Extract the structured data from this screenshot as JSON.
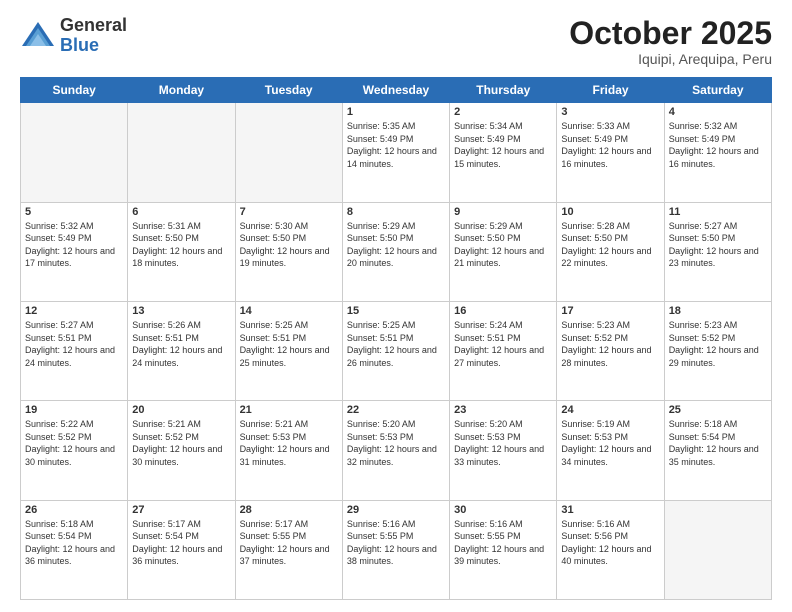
{
  "logo": {
    "general": "General",
    "blue": "Blue"
  },
  "header": {
    "month": "October 2025",
    "location": "Iquipi, Arequipa, Peru"
  },
  "weekdays": [
    "Sunday",
    "Monday",
    "Tuesday",
    "Wednesday",
    "Thursday",
    "Friday",
    "Saturday"
  ],
  "weeks": [
    [
      {
        "day": "",
        "sunrise": "",
        "sunset": "",
        "daylight": "",
        "empty": true
      },
      {
        "day": "",
        "sunrise": "",
        "sunset": "",
        "daylight": "",
        "empty": true
      },
      {
        "day": "",
        "sunrise": "",
        "sunset": "",
        "daylight": "",
        "empty": true
      },
      {
        "day": "1",
        "sunrise": "Sunrise: 5:35 AM",
        "sunset": "Sunset: 5:49 PM",
        "daylight": "Daylight: 12 hours and 14 minutes."
      },
      {
        "day": "2",
        "sunrise": "Sunrise: 5:34 AM",
        "sunset": "Sunset: 5:49 PM",
        "daylight": "Daylight: 12 hours and 15 minutes."
      },
      {
        "day": "3",
        "sunrise": "Sunrise: 5:33 AM",
        "sunset": "Sunset: 5:49 PM",
        "daylight": "Daylight: 12 hours and 16 minutes."
      },
      {
        "day": "4",
        "sunrise": "Sunrise: 5:32 AM",
        "sunset": "Sunset: 5:49 PM",
        "daylight": "Daylight: 12 hours and 16 minutes."
      }
    ],
    [
      {
        "day": "5",
        "sunrise": "Sunrise: 5:32 AM",
        "sunset": "Sunset: 5:49 PM",
        "daylight": "Daylight: 12 hours and 17 minutes."
      },
      {
        "day": "6",
        "sunrise": "Sunrise: 5:31 AM",
        "sunset": "Sunset: 5:50 PM",
        "daylight": "Daylight: 12 hours and 18 minutes."
      },
      {
        "day": "7",
        "sunrise": "Sunrise: 5:30 AM",
        "sunset": "Sunset: 5:50 PM",
        "daylight": "Daylight: 12 hours and 19 minutes."
      },
      {
        "day": "8",
        "sunrise": "Sunrise: 5:29 AM",
        "sunset": "Sunset: 5:50 PM",
        "daylight": "Daylight: 12 hours and 20 minutes."
      },
      {
        "day": "9",
        "sunrise": "Sunrise: 5:29 AM",
        "sunset": "Sunset: 5:50 PM",
        "daylight": "Daylight: 12 hours and 21 minutes."
      },
      {
        "day": "10",
        "sunrise": "Sunrise: 5:28 AM",
        "sunset": "Sunset: 5:50 PM",
        "daylight": "Daylight: 12 hours and 22 minutes."
      },
      {
        "day": "11",
        "sunrise": "Sunrise: 5:27 AM",
        "sunset": "Sunset: 5:50 PM",
        "daylight": "Daylight: 12 hours and 23 minutes."
      }
    ],
    [
      {
        "day": "12",
        "sunrise": "Sunrise: 5:27 AM",
        "sunset": "Sunset: 5:51 PM",
        "daylight": "Daylight: 12 hours and 24 minutes."
      },
      {
        "day": "13",
        "sunrise": "Sunrise: 5:26 AM",
        "sunset": "Sunset: 5:51 PM",
        "daylight": "Daylight: 12 hours and 24 minutes."
      },
      {
        "day": "14",
        "sunrise": "Sunrise: 5:25 AM",
        "sunset": "Sunset: 5:51 PM",
        "daylight": "Daylight: 12 hours and 25 minutes."
      },
      {
        "day": "15",
        "sunrise": "Sunrise: 5:25 AM",
        "sunset": "Sunset: 5:51 PM",
        "daylight": "Daylight: 12 hours and 26 minutes."
      },
      {
        "day": "16",
        "sunrise": "Sunrise: 5:24 AM",
        "sunset": "Sunset: 5:51 PM",
        "daylight": "Daylight: 12 hours and 27 minutes."
      },
      {
        "day": "17",
        "sunrise": "Sunrise: 5:23 AM",
        "sunset": "Sunset: 5:52 PM",
        "daylight": "Daylight: 12 hours and 28 minutes."
      },
      {
        "day": "18",
        "sunrise": "Sunrise: 5:23 AM",
        "sunset": "Sunset: 5:52 PM",
        "daylight": "Daylight: 12 hours and 29 minutes."
      }
    ],
    [
      {
        "day": "19",
        "sunrise": "Sunrise: 5:22 AM",
        "sunset": "Sunset: 5:52 PM",
        "daylight": "Daylight: 12 hours and 30 minutes."
      },
      {
        "day": "20",
        "sunrise": "Sunrise: 5:21 AM",
        "sunset": "Sunset: 5:52 PM",
        "daylight": "Daylight: 12 hours and 30 minutes."
      },
      {
        "day": "21",
        "sunrise": "Sunrise: 5:21 AM",
        "sunset": "Sunset: 5:53 PM",
        "daylight": "Daylight: 12 hours and 31 minutes."
      },
      {
        "day": "22",
        "sunrise": "Sunrise: 5:20 AM",
        "sunset": "Sunset: 5:53 PM",
        "daylight": "Daylight: 12 hours and 32 minutes."
      },
      {
        "day": "23",
        "sunrise": "Sunrise: 5:20 AM",
        "sunset": "Sunset: 5:53 PM",
        "daylight": "Daylight: 12 hours and 33 minutes."
      },
      {
        "day": "24",
        "sunrise": "Sunrise: 5:19 AM",
        "sunset": "Sunset: 5:53 PM",
        "daylight": "Daylight: 12 hours and 34 minutes."
      },
      {
        "day": "25",
        "sunrise": "Sunrise: 5:18 AM",
        "sunset": "Sunset: 5:54 PM",
        "daylight": "Daylight: 12 hours and 35 minutes."
      }
    ],
    [
      {
        "day": "26",
        "sunrise": "Sunrise: 5:18 AM",
        "sunset": "Sunset: 5:54 PM",
        "daylight": "Daylight: 12 hours and 36 minutes."
      },
      {
        "day": "27",
        "sunrise": "Sunrise: 5:17 AM",
        "sunset": "Sunset: 5:54 PM",
        "daylight": "Daylight: 12 hours and 36 minutes."
      },
      {
        "day": "28",
        "sunrise": "Sunrise: 5:17 AM",
        "sunset": "Sunset: 5:55 PM",
        "daylight": "Daylight: 12 hours and 37 minutes."
      },
      {
        "day": "29",
        "sunrise": "Sunrise: 5:16 AM",
        "sunset": "Sunset: 5:55 PM",
        "daylight": "Daylight: 12 hours and 38 minutes."
      },
      {
        "day": "30",
        "sunrise": "Sunrise: 5:16 AM",
        "sunset": "Sunset: 5:55 PM",
        "daylight": "Daylight: 12 hours and 39 minutes."
      },
      {
        "day": "31",
        "sunrise": "Sunrise: 5:16 AM",
        "sunset": "Sunset: 5:56 PM",
        "daylight": "Daylight: 12 hours and 40 minutes."
      },
      {
        "day": "",
        "sunrise": "",
        "sunset": "",
        "daylight": "",
        "empty": true
      }
    ]
  ]
}
